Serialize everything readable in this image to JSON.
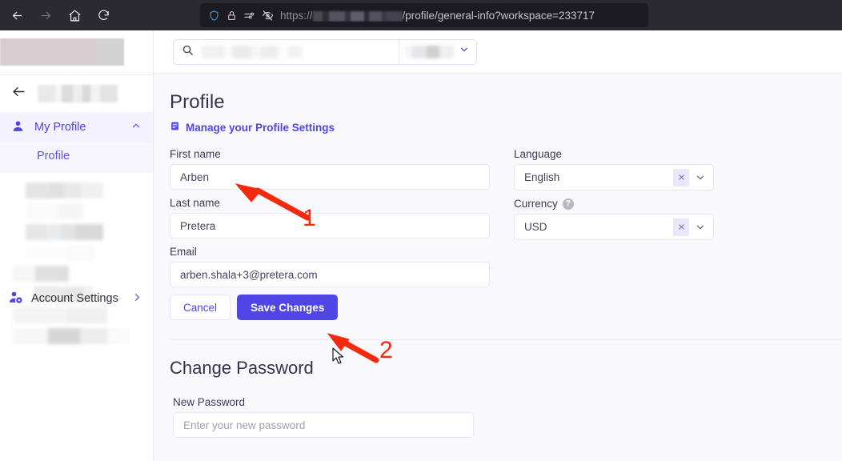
{
  "browser": {
    "back_icon": "back-arrow-icon",
    "forward_icon": "forward-arrow-icon",
    "home_icon": "home-icon",
    "reload_icon": "reload-icon",
    "shield_icon": "shield-icon",
    "lock_icon": "lock-icon",
    "permissions_icon": "permissions-icon",
    "tracking_blocked_icon": "tracking-protection-off-icon",
    "url_scheme": "https://",
    "url_domain_redacted": "",
    "url_path": "/profile/general-info?workspace=233717"
  },
  "sidebar": {
    "brand_logo": "brand-logo-redacted",
    "back_icon": "back-arrow-icon",
    "workspace_name": "",
    "my_profile": {
      "label": "My Profile",
      "icon": "user-icon",
      "chevron": "chevron-up-icon"
    },
    "sub_items": [
      {
        "label": "Profile"
      }
    ],
    "redacted_items": [
      "",
      "",
      "",
      "",
      "",
      "",
      "",
      ""
    ],
    "account_settings": {
      "label": "Account Settings",
      "icon": "user-gear-icon",
      "chevron": "chevron-right-icon"
    }
  },
  "topbar": {
    "search": {
      "icon": "search-icon",
      "value": "",
      "placeholder": "",
      "scope_value": "",
      "caret_icon": "chevron-down-icon"
    }
  },
  "page": {
    "title": "Profile",
    "manage_link": {
      "label": "Manage your Profile Settings",
      "icon": "book-icon"
    },
    "fields": {
      "first_name": {
        "label": "First name",
        "value": "Arben"
      },
      "last_name": {
        "label": "Last name",
        "value": "Pretera"
      },
      "email": {
        "label": "Email",
        "value": "arben.shala+3@pretera.com"
      },
      "language": {
        "label": "Language",
        "value": "English",
        "clear_icon": "close-icon",
        "caret_icon": "chevron-down-icon"
      },
      "currency": {
        "label": "Currency",
        "value": "USD",
        "help_icon": "help-icon",
        "help_glyph": "?",
        "clear_icon": "close-icon",
        "caret_icon": "chevron-down-icon"
      }
    },
    "buttons": {
      "cancel": "Cancel",
      "save": "Save Changes"
    },
    "change_password": {
      "title": "Change Password",
      "new_password": {
        "label": "New Password",
        "value": "",
        "placeholder": "Enter your new password"
      }
    }
  },
  "annotations": [
    {
      "number": "1",
      "target": "first-name-input",
      "color": "#f32a0e"
    },
    {
      "number": "2",
      "target": "save-changes-button",
      "color": "#f32a0e"
    }
  ],
  "colors": {
    "accent": "#4f46e5",
    "annotation": "#f32a0e",
    "chrome_bg": "#2b2a33",
    "page_bg": "#f9f9fd"
  }
}
